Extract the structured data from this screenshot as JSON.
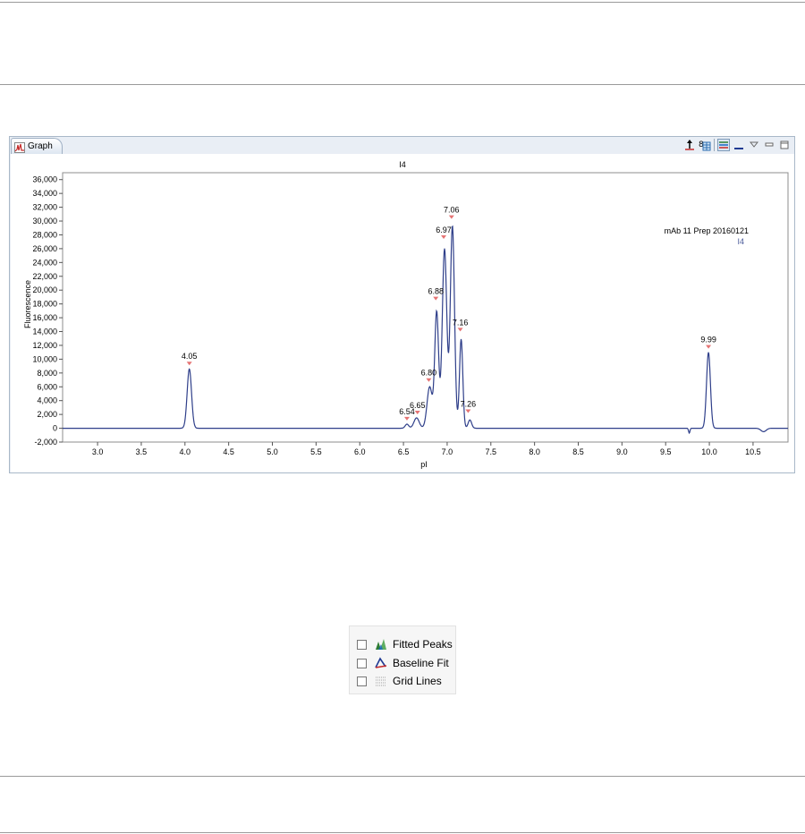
{
  "graph_view": {
    "tab_label": "Graph",
    "toolbar_icons": [
      "pin-icon",
      "table-icon",
      "legend-icon",
      "minimize-icon",
      "view-menu-icon",
      "maximize-icon"
    ]
  },
  "chart_data": {
    "type": "line",
    "title": "I4",
    "xlabel": "pI",
    "ylabel": "Fluorescence",
    "xlim": [
      2.6,
      10.9
    ],
    "ylim": [
      -2000,
      37000
    ],
    "x_ticks": [
      "3.0",
      "3.5",
      "4.0",
      "4.5",
      "5.0",
      "5.5",
      "6.0",
      "6.5",
      "7.0",
      "7.5",
      "8.0",
      "8.5",
      "9.0",
      "9.5",
      "10.0",
      "10.5"
    ],
    "y_ticks": [
      "-2,000",
      "0",
      "2,000",
      "4,000",
      "6,000",
      "8,000",
      "10,000",
      "12,000",
      "14,000",
      "16,000",
      "18,000",
      "20,000",
      "22,000",
      "24,000",
      "26,000",
      "28,000",
      "30,000",
      "32,000",
      "34,000",
      "36,000"
    ],
    "legend": {
      "title": "mAb 11 Prep 20160121",
      "entry": "I4",
      "position": "top-right"
    },
    "grid": false,
    "series_color": "#2f3f8a",
    "marker_color": "#e57373",
    "series": [
      {
        "name": "I4",
        "peaks": [
          {
            "x": 4.05,
            "y": 8600,
            "w": 0.025
          },
          {
            "x": 6.54,
            "y": 600,
            "w": 0.02
          },
          {
            "x": 6.65,
            "y": 1500,
            "w": 0.03
          },
          {
            "x": 6.8,
            "y": 6000,
            "w": 0.03
          },
          {
            "x": 6.88,
            "y": 16800,
            "w": 0.022
          },
          {
            "x": 6.97,
            "y": 26000,
            "w": 0.026
          },
          {
            "x": 7.06,
            "y": 29300,
            "w": 0.024
          },
          {
            "x": 7.16,
            "y": 12900,
            "w": 0.019
          },
          {
            "x": 7.26,
            "y": 1200,
            "w": 0.02
          },
          {
            "x": 9.99,
            "y": 11000,
            "w": 0.022
          }
        ],
        "dips": [
          {
            "x": 9.77,
            "y": -700,
            "w": 0.008
          },
          {
            "x": 10.62,
            "y": -500,
            "w": 0.03
          }
        ]
      }
    ],
    "peak_labels": [
      {
        "label": "4.05",
        "x": 4.05,
        "y": 8600
      },
      {
        "label": "6.54",
        "x": 6.54,
        "y": 600
      },
      {
        "label": "6.65",
        "x": 6.66,
        "y": 1500
      },
      {
        "label": "6.80",
        "x": 6.79,
        "y": 6200
      },
      {
        "label": "6.88",
        "x": 6.87,
        "y": 18000
      },
      {
        "label": "6.97",
        "x": 6.96,
        "y": 26900
      },
      {
        "label": "7.06",
        "x": 7.05,
        "y": 29800
      },
      {
        "label": "7.16",
        "x": 7.15,
        "y": 13500
      },
      {
        "label": "7.26",
        "x": 7.24,
        "y": 1700
      },
      {
        "label": "9.99",
        "x": 9.99,
        "y": 11000
      }
    ]
  },
  "options": [
    {
      "label": "Fitted Peaks",
      "icon": "fitted-peaks-icon",
      "checked": false
    },
    {
      "label": "Baseline Fit",
      "icon": "baseline-fit-icon",
      "checked": false
    },
    {
      "label": "Grid Lines",
      "icon": "grid-lines-icon",
      "checked": false
    }
  ]
}
